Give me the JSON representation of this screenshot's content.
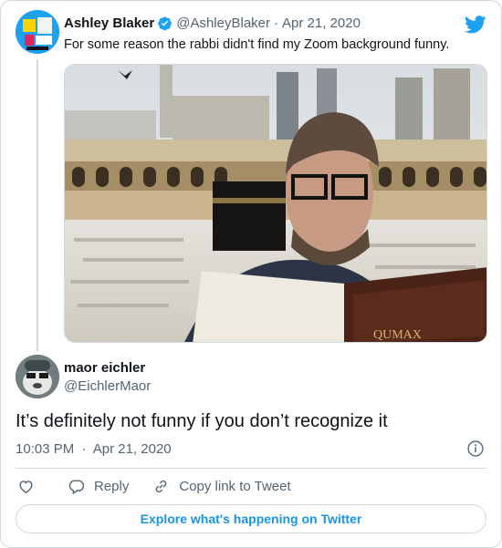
{
  "parent_tweet": {
    "author_name": "Ashley Blaker",
    "handle": "@AshleyBlaker",
    "separator": "·",
    "date": "Apr 21, 2020",
    "text": "For some reason the rabbi didn't find my Zoom background funny.",
    "avatar_icon": "profile-avatar",
    "verified_icon": "verified-badge-icon",
    "brand_icon": "twitter-bird-icon",
    "media_book_text": "QUMAX"
  },
  "main_tweet": {
    "author_name": "maor eichler",
    "handle": "@EichlerMaor",
    "text": "It’s definitely not funny if you don’t recognize it",
    "time": "10:03 PM",
    "separator": "·",
    "date": "Apr 21, 2020"
  },
  "actions": {
    "like_label": "",
    "reply_label": "Reply",
    "copy_link_label": "Copy link to Tweet"
  },
  "footer": {
    "explore_label": "Explore what's happening on Twitter"
  },
  "colors": {
    "twitter_blue": "#1da1f2",
    "link_blue": "#1b95e0",
    "muted_text": "#536471",
    "border": "#cfd9de"
  }
}
